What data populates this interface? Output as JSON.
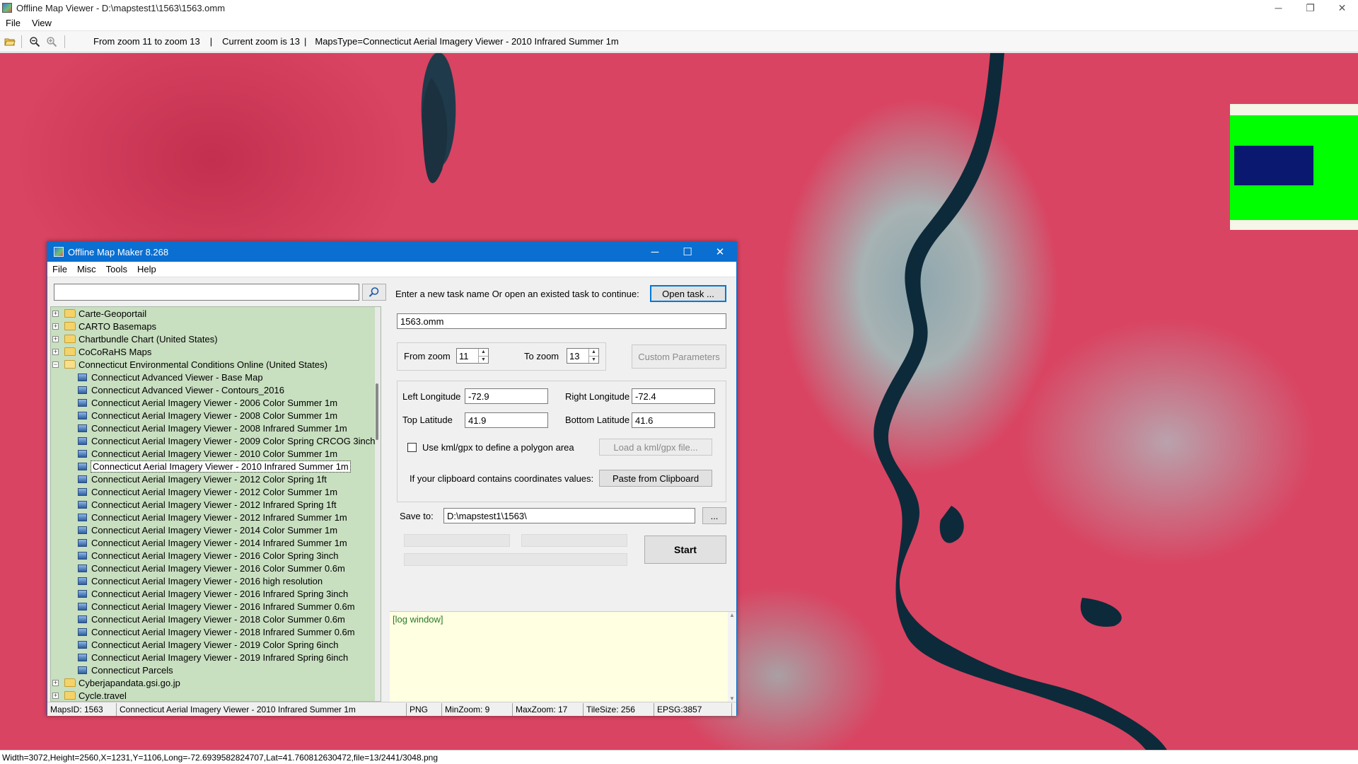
{
  "window": {
    "title": "Offline Map Viewer - D:\\mapstest1\\1563\\1563.omm",
    "controls": {
      "minimize": "─",
      "maximize": "❐",
      "close": "✕"
    }
  },
  "menu": [
    "File",
    "View"
  ],
  "toolbar": {
    "zoom_range": "From zoom 11 to zoom 13",
    "separator": "|",
    "current_zoom": "Current zoom is 13",
    "separator2": "|",
    "maps_type": "MapsType=Connecticut Aerial Imagery Viewer - 2010 Infrared Summer 1m"
  },
  "status_bar": {
    "text": "Width=3072,Height=2560,X=1231,Y=1106,Long=-72.6939582824707,Lat=41.760812630472,file=13/2441/3048.png"
  },
  "colors": {
    "map_base": "#d94462",
    "river": "#0d2a3a",
    "minimap_green": "#00ff00",
    "minimap_navy": "#0a1870",
    "dialog_accent": "#0a6fd1",
    "tree_bg": "#c8dfc0",
    "log_bg": "#ffffe1"
  },
  "dialog": {
    "title": "Offline Map Maker 8.268",
    "controls": {
      "minimize": "─",
      "maximize": "☐",
      "close": "✕"
    },
    "menu": [
      "File",
      "Misc",
      "Tools",
      "Help"
    ],
    "search": {
      "value": "",
      "icon": "magnifier-icon"
    },
    "tree": [
      {
        "label": "Carte-Geoportail",
        "type": "folder",
        "expander": "+"
      },
      {
        "label": "CARTO Basemaps",
        "type": "folder",
        "expander": "+"
      },
      {
        "label": "Chartbundle Chart (United States)",
        "type": "folder",
        "expander": "+"
      },
      {
        "label": "CoCoRaHS Maps",
        "type": "folder",
        "expander": "+"
      },
      {
        "label": "Connecticut Environmental Conditions Online (United States)",
        "type": "folder-open",
        "expander": "−"
      },
      {
        "label": "Connecticut Advanced Viewer - Base Map",
        "type": "map"
      },
      {
        "label": "Connecticut Advanced Viewer - Contours_2016",
        "type": "map"
      },
      {
        "label": "Connecticut Aerial Imagery Viewer - 2006 Color Summer 1m",
        "type": "map"
      },
      {
        "label": "Connecticut Aerial Imagery Viewer - 2008 Color Summer 1m",
        "type": "map"
      },
      {
        "label": "Connecticut Aerial Imagery Viewer - 2008 Infrared Summer 1m",
        "type": "map"
      },
      {
        "label": "Connecticut Aerial Imagery Viewer - 2009 Color Spring CRCOG 3inch",
        "type": "map"
      },
      {
        "label": "Connecticut Aerial Imagery Viewer - 2010 Color Summer 1m",
        "type": "map"
      },
      {
        "label": "Connecticut Aerial Imagery Viewer - 2010 Infrared Summer 1m",
        "type": "map",
        "selected": true
      },
      {
        "label": "Connecticut Aerial Imagery Viewer - 2012 Color Spring 1ft",
        "type": "map"
      },
      {
        "label": "Connecticut Aerial Imagery Viewer - 2012 Color Summer 1m",
        "type": "map"
      },
      {
        "label": "Connecticut Aerial Imagery Viewer - 2012 Infrared Spring 1ft",
        "type": "map"
      },
      {
        "label": "Connecticut Aerial Imagery Viewer - 2012 Infrared Summer 1m",
        "type": "map"
      },
      {
        "label": "Connecticut Aerial Imagery Viewer - 2014 Color Summer 1m",
        "type": "map"
      },
      {
        "label": "Connecticut Aerial Imagery Viewer - 2014 Infrared Summer 1m",
        "type": "map"
      },
      {
        "label": "Connecticut Aerial Imagery Viewer - 2016 Color Spring 3inch",
        "type": "map"
      },
      {
        "label": "Connecticut Aerial Imagery Viewer - 2016 Color Summer 0.6m",
        "type": "map"
      },
      {
        "label": "Connecticut Aerial Imagery Viewer - 2016 high resolution",
        "type": "map"
      },
      {
        "label": "Connecticut Aerial Imagery Viewer - 2016 Infrared Spring 3inch",
        "type": "map"
      },
      {
        "label": "Connecticut Aerial Imagery Viewer - 2016 Infrared Summer 0.6m",
        "type": "map"
      },
      {
        "label": "Connecticut Aerial Imagery Viewer - 2018 Color Summer 0.6m",
        "type": "map"
      },
      {
        "label": "Connecticut Aerial Imagery Viewer - 2018 Infrared Summer 0.6m",
        "type": "map"
      },
      {
        "label": "Connecticut Aerial Imagery Viewer - 2019 Color Spring 6inch",
        "type": "map"
      },
      {
        "label": "Connecticut Aerial Imagery Viewer - 2019 Infrared Spring 6inch",
        "type": "map"
      },
      {
        "label": "Connecticut Parcels",
        "type": "map"
      },
      {
        "label": "Cyberjapandata.gsi.go.jp",
        "type": "folder",
        "expander": "+"
      },
      {
        "label": "Cycle.travel",
        "type": "folder",
        "expander": "+"
      }
    ],
    "task": {
      "prompt": "Enter a new task name Or open an existed task to continue:",
      "open_button": "Open task ...",
      "name_value": "1563.omm"
    },
    "zoom": {
      "from_label": "From zoom",
      "from_value": "11",
      "to_label": "To zoom",
      "to_value": "13",
      "custom_button": "Custom Parameters"
    },
    "bounds": {
      "left_label": "Left Longitude",
      "left_value": "-72.9",
      "right_label": "Right Longitude",
      "right_value": "-72.4",
      "top_label": "Top Latitude",
      "top_value": "41.9",
      "bottom_label": "Bottom Latitude",
      "bottom_value": "41.6",
      "kml_checkbox_label": "Use kml/gpx to define a polygon area",
      "kml_button": "Load a kml/gpx file...",
      "clipboard_label": "If your clipboard contains coordinates values:",
      "clipboard_button": "Paste from Clipboard"
    },
    "save": {
      "label": "Save to:",
      "value": "D:\\mapstest1\\1563\\",
      "browse_button": "...",
      "start_button": "Start"
    },
    "log": {
      "text": "[log window]"
    },
    "status": {
      "maps_id": "MapsID: 1563",
      "name": "Connecticut Aerial Imagery Viewer - 2010 Infrared Summer 1m",
      "format": "PNG",
      "min_zoom": "MinZoom: 9",
      "max_zoom": "MaxZoom: 17",
      "tile_size": "TileSize: 256",
      "epsg": "EPSG:3857"
    }
  }
}
